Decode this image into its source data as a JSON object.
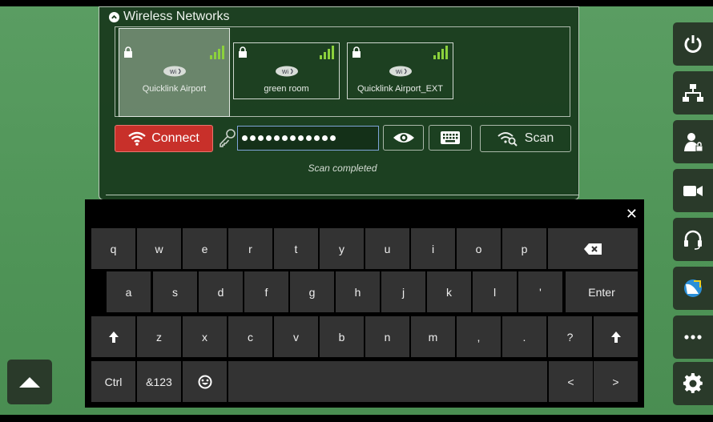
{
  "wireless": {
    "title": "Wireless Networks",
    "networks": [
      {
        "name": "Quicklink Airport",
        "selected": true,
        "wifi_badge": "Wi"
      },
      {
        "name": "green room",
        "selected": false,
        "wifi_badge": "Wi"
      },
      {
        "name": "Quicklink Airport_EXT",
        "selected": false,
        "wifi_badge": "Wi"
      }
    ],
    "connect_label": "Connect",
    "password_dots": 12,
    "scan_label": "Scan",
    "status": "Scan completed"
  },
  "sidebar": {
    "items": [
      {
        "icon": "power-icon"
      },
      {
        "icon": "network-icon"
      },
      {
        "icon": "user-lock-icon"
      },
      {
        "icon": "camera-icon"
      },
      {
        "icon": "headset-icon"
      },
      {
        "icon": "satellite-icon"
      },
      {
        "icon": "more-icon"
      },
      {
        "icon": "gear-icon"
      }
    ]
  },
  "keyboard": {
    "close": "✕",
    "row1": [
      "q",
      "w",
      "e",
      "r",
      "t",
      "y",
      "u",
      "i",
      "o",
      "p"
    ],
    "row2": [
      "a",
      "s",
      "d",
      "f",
      "g",
      "h",
      "j",
      "k",
      "l",
      "'"
    ],
    "row2_enter": "Enter",
    "row3": [
      "z",
      "x",
      "c",
      "v",
      "b",
      "n",
      "m",
      ",",
      ".",
      "?"
    ],
    "row4_ctrl": "Ctrl",
    "row4_sym": "&123",
    "row4_left": "<",
    "row4_right": ">"
  },
  "colors": {
    "accent_red": "#c8302a",
    "signal_green": "#8cd13c",
    "background_green": "#4f9457"
  }
}
